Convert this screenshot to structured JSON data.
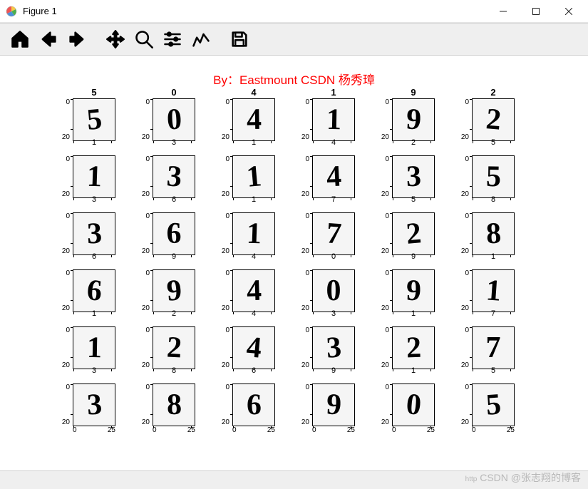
{
  "window": {
    "title": "Figure 1"
  },
  "toolbar": {
    "home": "Home",
    "back": "Back",
    "forward": "Forward",
    "pan": "Pan",
    "zoom": "Zoom",
    "configure": "Configure subplots",
    "edit": "Edit axis",
    "save": "Save"
  },
  "figure": {
    "title": "By：Eastmount CSDN 杨秀璋"
  },
  "watermark": {
    "prefix": "http",
    "text": "CSDN @张志翔的博客"
  },
  "chart_data": {
    "type": "grid-of-images",
    "description": "6x6 grid of 28x28 grayscale MNIST handwritten digit images. Column headers are predicted labels for first row; each cell shows an image with its true label below.",
    "image_dims": [
      28,
      28
    ],
    "y_ticks": [
      0,
      20
    ],
    "x_ticks": [
      0,
      25
    ],
    "column_headers": [
      "5",
      "0",
      "4",
      "1",
      "9",
      "2"
    ],
    "show_x_ticks_on_last_row": true,
    "cells": [
      [
        {
          "digit": "5",
          "label": "1"
        },
        {
          "digit": "0",
          "label": "3"
        },
        {
          "digit": "4",
          "label": "1"
        },
        {
          "digit": "1",
          "label": "4"
        },
        {
          "digit": "9",
          "label": "2"
        },
        {
          "digit": "2",
          "label": "5"
        }
      ],
      [
        {
          "digit": "1",
          "label": "3"
        },
        {
          "digit": "3",
          "label": "6"
        },
        {
          "digit": "1",
          "label": "1"
        },
        {
          "digit": "4",
          "label": "7"
        },
        {
          "digit": "3",
          "label": "5"
        },
        {
          "digit": "5",
          "label": "8"
        }
      ],
      [
        {
          "digit": "3",
          "label": "6"
        },
        {
          "digit": "6",
          "label": "9"
        },
        {
          "digit": "1",
          "label": "4"
        },
        {
          "digit": "7",
          "label": "0"
        },
        {
          "digit": "2",
          "label": "9"
        },
        {
          "digit": "8",
          "label": "1"
        }
      ],
      [
        {
          "digit": "6",
          "label": "1"
        },
        {
          "digit": "9",
          "label": "2"
        },
        {
          "digit": "4",
          "label": "4"
        },
        {
          "digit": "0",
          "label": "3"
        },
        {
          "digit": "9",
          "label": "1"
        },
        {
          "digit": "1",
          "label": "7"
        }
      ],
      [
        {
          "digit": "1",
          "label": "3"
        },
        {
          "digit": "2",
          "label": "8"
        },
        {
          "digit": "4",
          "label": "6"
        },
        {
          "digit": "3",
          "label": "9"
        },
        {
          "digit": "2",
          "label": "1"
        },
        {
          "digit": "7",
          "label": "5"
        }
      ],
      [
        {
          "digit": "3",
          "label": ""
        },
        {
          "digit": "8",
          "label": ""
        },
        {
          "digit": "6",
          "label": ""
        },
        {
          "digit": "9",
          "label": ""
        },
        {
          "digit": "0",
          "label": ""
        },
        {
          "digit": "5",
          "label": ""
        }
      ]
    ]
  }
}
